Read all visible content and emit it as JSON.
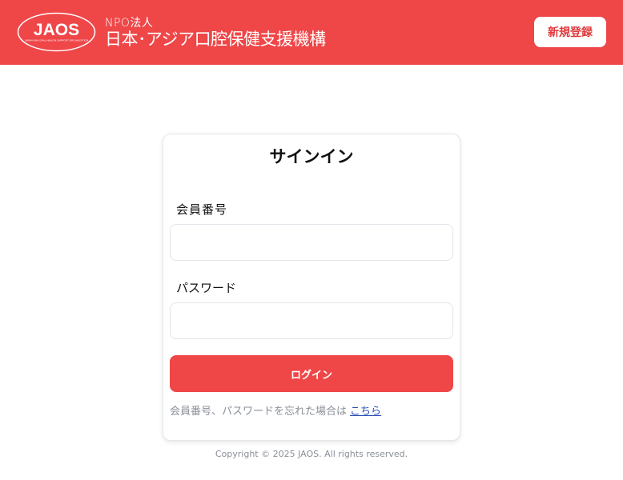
{
  "header": {
    "logo_text": "JAOS",
    "logo_tagline": "JAPAN ASIA ORAL HEALTH SUPPORT ORGANIZATION",
    "org_type": "NPO法人",
    "org_name": "日本･アジア口腔保健支援機構",
    "register_label": "新規登録"
  },
  "signin": {
    "title": "サインイン",
    "member_label": "会員番号",
    "member_value": "",
    "password_label": "パスワード",
    "password_value": "",
    "login_label": "ログイン",
    "forgot_text": "会員番号、パスワードを忘れた場合は",
    "forgot_link": "こちら"
  },
  "footer": {
    "copyright": "Copyright © 2025 JAOS. All rights reserved."
  },
  "colors": {
    "brand": "#ef4648",
    "link": "#2c4fb5",
    "muted": "#8a8f98"
  }
}
